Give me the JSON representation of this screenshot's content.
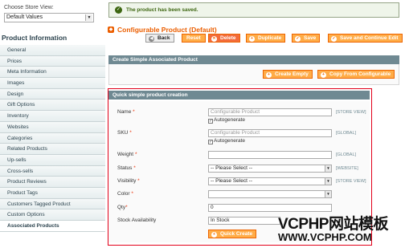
{
  "sidebar": {
    "store_view_label": "Choose Store View:",
    "store_view_value": "Default Values",
    "title": "Product Information",
    "tabs": [
      {
        "label": "General"
      },
      {
        "label": "Prices"
      },
      {
        "label": "Meta Information"
      },
      {
        "label": "Images"
      },
      {
        "label": "Design"
      },
      {
        "label": "Gift Options"
      },
      {
        "label": "Inventory"
      },
      {
        "label": "Websites"
      },
      {
        "label": "Categories"
      },
      {
        "label": "Related Products"
      },
      {
        "label": "Up-sells"
      },
      {
        "label": "Cross-sells"
      },
      {
        "label": "Product Reviews"
      },
      {
        "label": "Product Tags"
      },
      {
        "label": "Customers Tagged Product"
      },
      {
        "label": "Custom Options"
      },
      {
        "label": "Associated Products"
      }
    ],
    "active_tab": "Associated Products"
  },
  "message": {
    "text": "The product has been saved."
  },
  "header": {
    "title": "Configurable Product (Default)",
    "buttons": {
      "back": "Back",
      "reset": "Reset",
      "delete": "Delete",
      "duplicate": "Duplicate",
      "save": "Save",
      "save_continue": "Save and Continue Edit"
    }
  },
  "create_simple": {
    "title": "Create Simple Associated Product",
    "create_empty": "Create Empty",
    "copy_from_configurable": "Copy From Configurable"
  },
  "quick_create": {
    "title": "Quick simple product creation",
    "name": {
      "label": "Name",
      "req": "*",
      "value": "Configurable Product",
      "autogenerate": "Autogenerate",
      "scope": "[STORE VIEW]"
    },
    "sku": {
      "label": "SKU",
      "req": "*",
      "value": "Configurable Product",
      "autogenerate": "Autogenerate",
      "scope": "[GLOBAL]"
    },
    "weight": {
      "label": "Weight",
      "req": "*",
      "value": "",
      "scope": "[GLOBAL]"
    },
    "status": {
      "label": "Status",
      "req": "*",
      "value": "-- Please Select --",
      "scope": "[WEBSITE]"
    },
    "visibility": {
      "label": "Visibility",
      "req": "*",
      "value": "-- Please Select --",
      "scope": "[STORE VIEW]"
    },
    "color": {
      "label": "Color",
      "req": "*",
      "value": ""
    },
    "qty": {
      "label": "Qty",
      "req": "*",
      "value": "0"
    },
    "stock": {
      "label": "Stock Availability",
      "value": "In Stock"
    },
    "button": "Quick Create"
  },
  "watermark": {
    "line1": "VCPHP网站模板",
    "line2": "WWW.VCPHP.COM"
  },
  "colors": {
    "accent": "#eb5e00",
    "panel_header": "#6f8992",
    "button": "#ffac47",
    "highlight_border": "#e2001a"
  }
}
